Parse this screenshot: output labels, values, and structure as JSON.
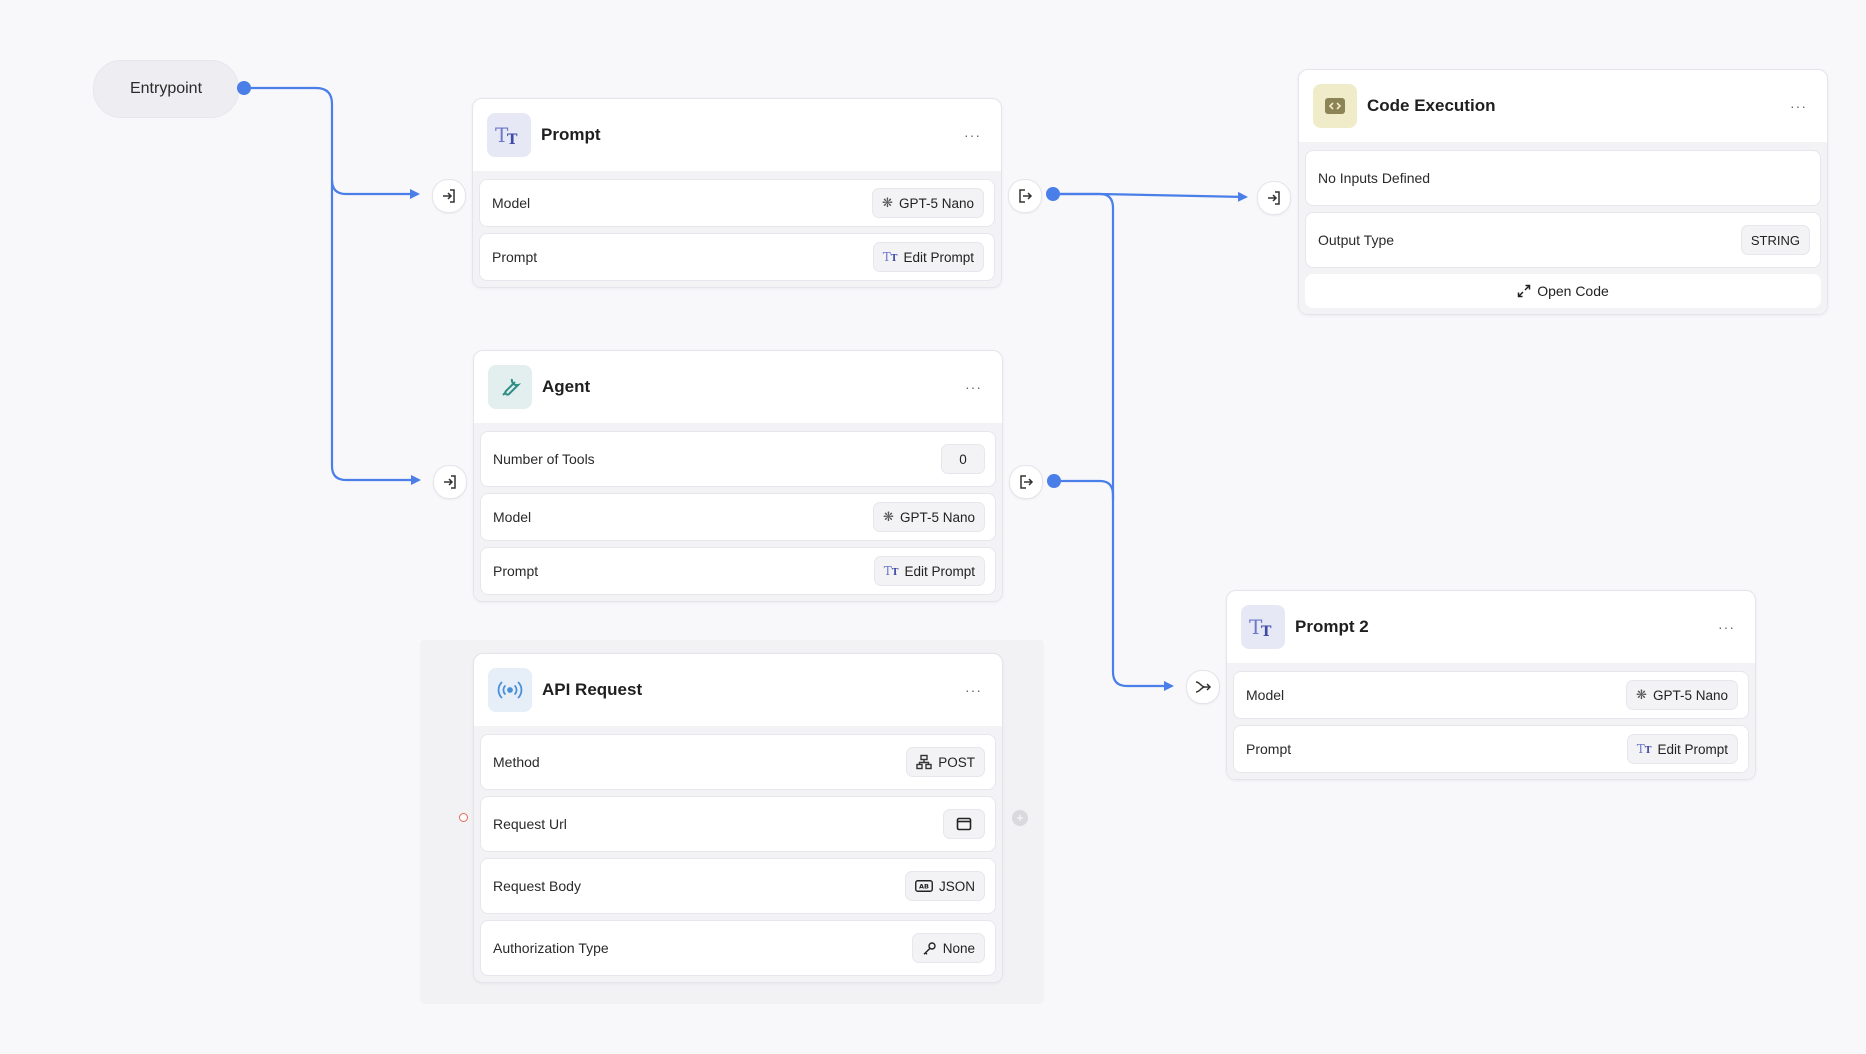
{
  "canvas": {
    "entrypoint_label": "Entrypoint",
    "edge_color": "#4a7ee8"
  },
  "nodes": {
    "prompt": {
      "title": "Prompt",
      "icon": "text-type-icon",
      "more": "···",
      "rows": {
        "model_label": "Model",
        "model_value": "GPT-5 Nano",
        "prompt_label": "Prompt",
        "prompt_value": "Edit Prompt"
      }
    },
    "agent": {
      "title": "Agent",
      "icon": "wrench-icon",
      "more": "···",
      "rows": {
        "tools_label": "Number of Tools",
        "tools_value": "0",
        "model_label": "Model",
        "model_value": "GPT-5 Nano",
        "prompt_label": "Prompt",
        "prompt_value": "Edit Prompt"
      }
    },
    "api_request": {
      "title": "API Request",
      "icon": "broadcast-icon",
      "more": "···",
      "rows": {
        "method_label": "Method",
        "method_value": "POST",
        "url_label": "Request Url",
        "body_label": "Request Body",
        "body_value": "JSON",
        "auth_label": "Authorization Type",
        "auth_value": "None"
      }
    },
    "code_execution": {
      "title": "Code Execution",
      "icon": "code-icon",
      "more": "···",
      "rows": {
        "inputs_label": "No Inputs Defined",
        "output_label": "Output Type",
        "output_value": "STRING",
        "open_code": "Open Code"
      }
    },
    "prompt2": {
      "title": "Prompt 2",
      "icon": "text-type-icon",
      "more": "···",
      "rows": {
        "model_label": "Model",
        "model_value": "GPT-5 Nano",
        "prompt_label": "Prompt",
        "prompt_value": "Edit Prompt"
      }
    }
  }
}
